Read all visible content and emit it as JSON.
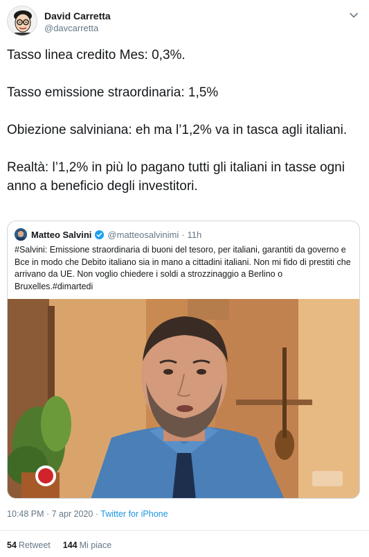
{
  "author": {
    "display_name": "David Carretta",
    "handle": "@davcarretta"
  },
  "tweet": {
    "paragraphs": [
      "Tasso linea credito Mes: 0,3%.",
      "Tasso emissione straordinaria: 1,5%",
      "Obiezione salviniana: eh ma l’1,2% va in tasca agli italiani.",
      "Realtà: l’1,2% in più lo pagano tutti gli italiani in tasse ogni anno a beneficio degli investitori."
    ]
  },
  "quoted": {
    "display_name": "Matteo Salvini",
    "handle": "@matteosalvinimi",
    "separator": "·",
    "time": "11h",
    "text": "#Salvini: Emissione straordinaria di buoni del tesoro, per italiani, garantiti da governo e Bce in modo che Debito italiano sia in mano a cittadini italiani. Non mi fido di prestiti che arrivano da UE. Non voglio chiedere i soldi a strozzinaggio a Berlino o Bruxelles.#dimartedi",
    "verified_color": "#1da1f2"
  },
  "footer": {
    "time": "10:48 PM · 7 apr 2020 · ",
    "source": "Twitter for iPhone",
    "retweets_count": "54",
    "retweets_label": "Retweet",
    "likes_count": "144",
    "likes_label": "Mi piace"
  },
  "icons": {
    "caret": "chevron-down-icon",
    "verified": "verified-badge-icon"
  },
  "colors": {
    "link": "#1b95e0",
    "muted": "#657786",
    "border": "#ccd6dd"
  }
}
